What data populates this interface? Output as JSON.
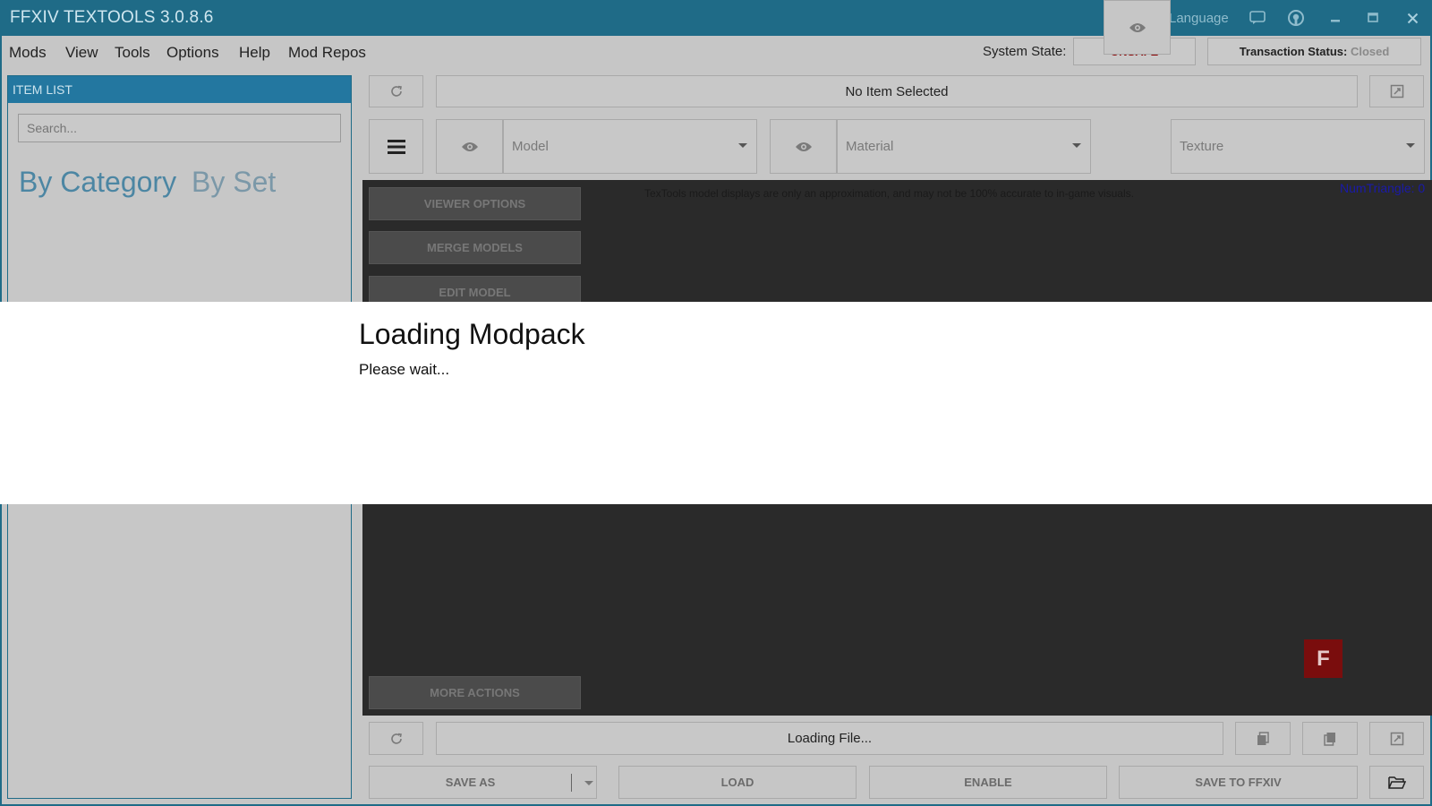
{
  "window": {
    "title": "FFXIV TEXTOOLS 3.0.8.6",
    "language_label": "Language"
  },
  "menu": {
    "items": [
      "Mods",
      "View",
      "Tools",
      "Options",
      "Help",
      "Mod Repos"
    ]
  },
  "status": {
    "system_state_label": "System State:",
    "system_state_value": "UNSAFE",
    "transaction_label": "Transaction Status:",
    "transaction_value": "Closed"
  },
  "item_list": {
    "header": "ITEM LIST",
    "search_placeholder": "Search...",
    "tabs": [
      "By Category",
      "By Set"
    ]
  },
  "top": {
    "selected_item": "No Item Selected"
  },
  "dropdowns": {
    "model": "Model",
    "material": "Material",
    "texture": "Texture"
  },
  "viewer": {
    "options_label": "VIEWER OPTIONS",
    "merge_label": "MERGE MODELS",
    "edit_label": "EDIT MODEL",
    "more_actions_label": "MORE ACTIONS",
    "notice": "TexTools model displays are only an approximation, and may not be 100% accurate to in-game visuals.",
    "num_triangle": "NumTriangle: 0",
    "badge": "F"
  },
  "bottom": {
    "loading_file": "Loading File...",
    "save_as": "SAVE AS",
    "load": "LOAD",
    "enable": "ENABLE",
    "save_to_ffxiv": "SAVE TO FFXIV"
  },
  "dialog": {
    "title": "Loading Modpack",
    "message": "Please wait..."
  },
  "colors": {
    "titlebar": "#1f6b87",
    "header": "#2377a0",
    "unsafe": "#8b0000",
    "tab_active": "#4c86a3"
  }
}
